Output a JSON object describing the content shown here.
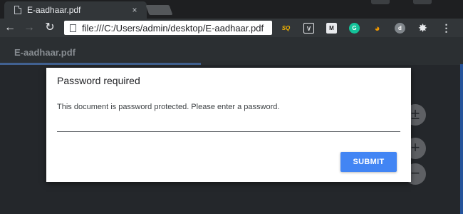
{
  "browser": {
    "tab_title": "E-aadhaar.pdf",
    "tab_close_icon": "×",
    "address": "file:///C:/Users/admin/desktop/E-aadhaar.pdf",
    "nav_icons": {
      "back": "←",
      "forward": "→",
      "reload": "↻"
    },
    "extensions": [
      {
        "name": "sq-extension-icon",
        "label": "SQ",
        "color": "#f4b400"
      },
      {
        "name": "shield-extension-icon",
        "label": "V",
        "color": "#9aa0a6"
      },
      {
        "name": "m-extension-icon",
        "label": "M",
        "color": "#5f6368"
      },
      {
        "name": "grammarly-extension-icon",
        "label": "G",
        "color": "#15c39a"
      },
      {
        "name": "orange-extension-icon",
        "label": "◕",
        "color": "#f29900"
      },
      {
        "name": "grey-extension-icon",
        "label": "d",
        "color": "#80868b"
      },
      {
        "name": "settings-extension-icon",
        "label": "✸",
        "color": "#323639"
      }
    ],
    "menu_icon": "⋮"
  },
  "viewer": {
    "title": "E-aadhaar.pdf",
    "fab_icons": [
      "±",
      "+",
      "−"
    ]
  },
  "dialog": {
    "title": "Password required",
    "message": "This document is password protected. Please enter a password.",
    "password_value": "",
    "submit_label": "SUBMIT"
  },
  "colors": {
    "accent": "#4285f4",
    "chrome_dark": "#323639",
    "viewer_background": "#2a2d31"
  }
}
